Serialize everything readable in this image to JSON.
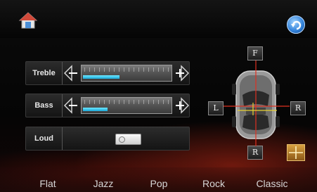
{
  "header": {
    "home_icon": "home-icon",
    "back_icon": "back-icon"
  },
  "tone": {
    "treble": {
      "label": "Treble",
      "level": 0.42
    },
    "bass": {
      "label": "Bass",
      "level": 0.28
    },
    "loud": {
      "label": "Loud",
      "on": false
    }
  },
  "balance": {
    "front_label": "F",
    "rear_label": "R",
    "left_label": "L",
    "right_label": "R",
    "center_icon": "crosshair-icon"
  },
  "presets": [
    {
      "label": "Flat"
    },
    {
      "label": "Jazz"
    },
    {
      "label": "Pop"
    },
    {
      "label": "Rock"
    },
    {
      "label": "Classic"
    }
  ],
  "colors": {
    "level_fill": "#1aa8d8",
    "balance_lines": "#e03020",
    "fader_line": "#e8d030"
  }
}
